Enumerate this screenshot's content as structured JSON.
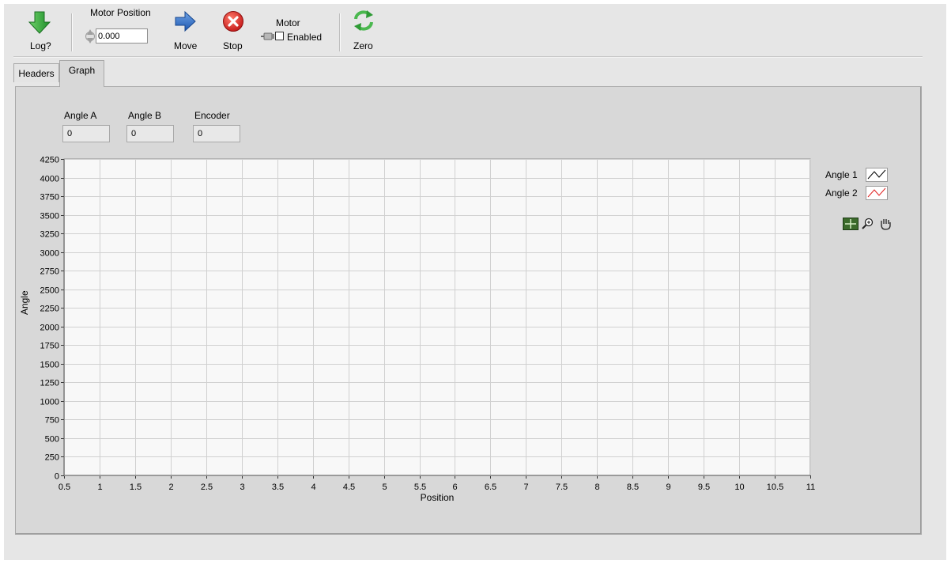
{
  "toolbar": {
    "log_label": "Log?",
    "motor_position_label": "Motor Position",
    "motor_position_value": "0.000",
    "move_label": "Move",
    "stop_label": "Stop",
    "motor_label": "Motor",
    "enabled_label": "Enabled",
    "enabled_checked": false,
    "zero_label": "Zero",
    "icons": {
      "log": "down-arrow-icon",
      "move": "right-arrow-icon",
      "stop": "stop-x-icon",
      "motor": "motor-icon",
      "zero": "refresh-arrows-icon"
    }
  },
  "tabs": [
    {
      "label": "Headers",
      "active": false
    },
    {
      "label": "Graph",
      "active": true
    }
  ],
  "indicators": [
    {
      "label": "Angle A",
      "value": "0"
    },
    {
      "label": "Angle B",
      "value": "0"
    },
    {
      "label": "Encoder",
      "value": "0"
    }
  ],
  "legend": [
    {
      "name": "Angle 1",
      "color": "#000000"
    },
    {
      "name": "Angle 2",
      "color": "#e02020"
    }
  ],
  "graph_palette": [
    "crosshair-cursor-icon",
    "zoom-icon",
    "pan-hand-icon"
  ],
  "chart_data": {
    "type": "line",
    "xlabel": "Position",
    "ylabel": "Angle",
    "xlim": [
      0.5,
      11
    ],
    "ylim": [
      0,
      4250
    ],
    "x_ticks": [
      "0.5",
      "1",
      "1.5",
      "2",
      "2.5",
      "3",
      "3.5",
      "4",
      "4.5",
      "5",
      "5.5",
      "6",
      "6.5",
      "7",
      "7.5",
      "8",
      "8.5",
      "9",
      "9.5",
      "10",
      "10.5",
      "11"
    ],
    "y_ticks": [
      "0",
      "250",
      "500",
      "750",
      "1000",
      "1250",
      "1500",
      "1750",
      "2000",
      "2250",
      "2500",
      "2750",
      "3000",
      "3250",
      "3500",
      "3750",
      "4000",
      "4250"
    ],
    "grid": true,
    "legend_position": "right",
    "series": [
      {
        "name": "Angle 1",
        "x": [],
        "y": []
      },
      {
        "name": "Angle 2",
        "x": [],
        "y": []
      }
    ]
  }
}
